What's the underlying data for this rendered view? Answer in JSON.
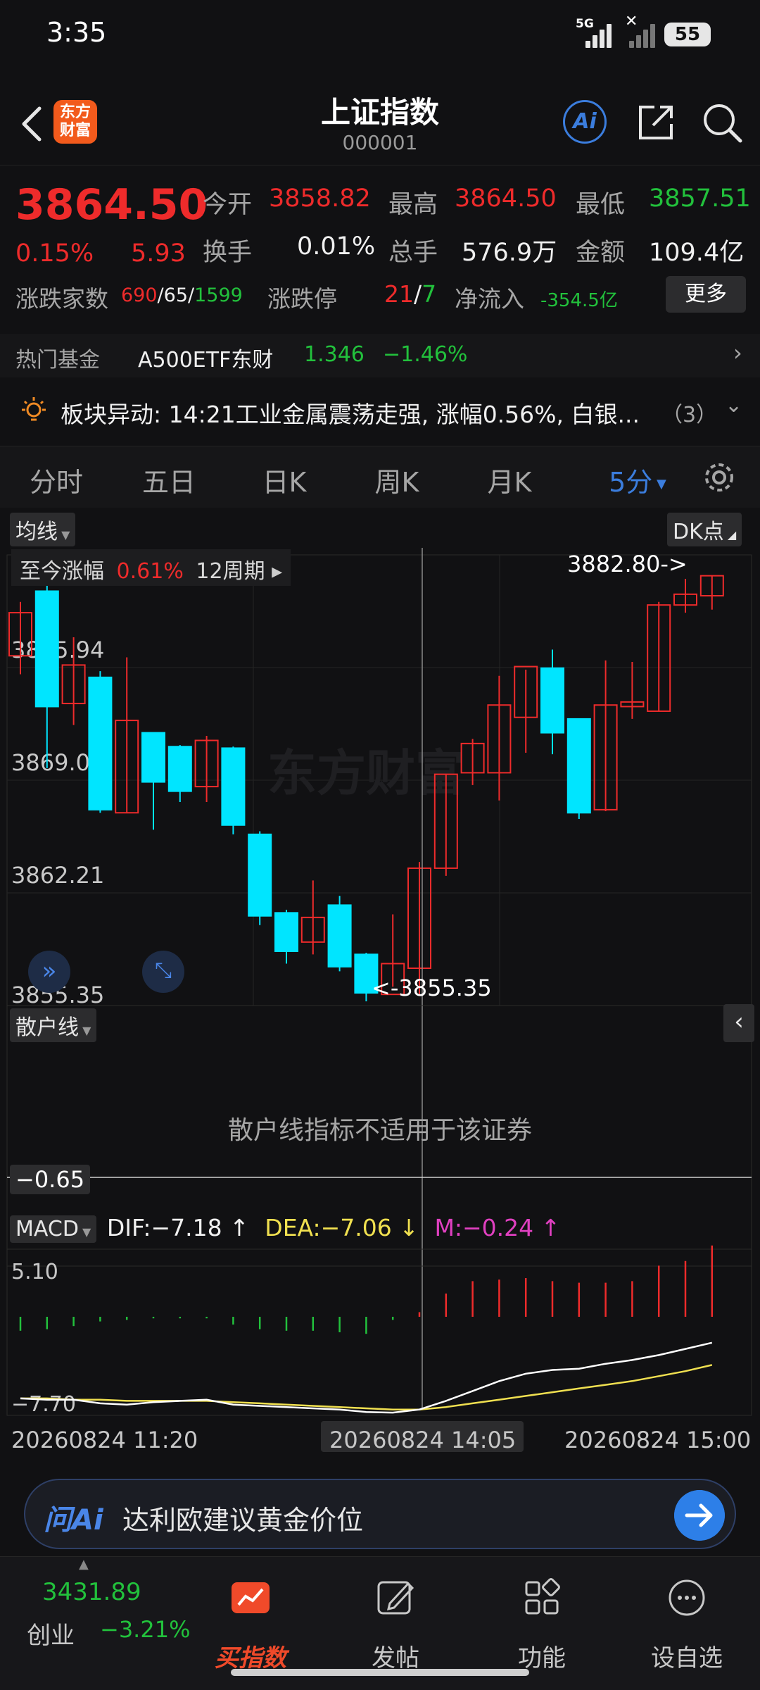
{
  "status_bar": {
    "time": "3:35",
    "network": "5G",
    "battery": "55"
  },
  "header": {
    "title": "上证指数",
    "code": "000001",
    "logo_text_1": "东方",
    "logo_text_2": "财富",
    "ai_label": "Ai"
  },
  "quote": {
    "price": "3864.50",
    "change_pct": "0.15%",
    "change_amt": "5.93",
    "open_label": "今开",
    "open": "3858.82",
    "high_label": "最高",
    "high": "3864.50",
    "low_label": "最低",
    "low": "3857.51",
    "turnover_label": "换手",
    "turnover": "0.01%",
    "volume_label": "总手",
    "volume": "576.9万",
    "amount_label": "金额",
    "amount": "109.4亿",
    "breadth_label": "涨跌家数",
    "breadth_up": "690",
    "breadth_flat": "/65/",
    "breadth_down": "1599",
    "limit_label": "涨跌停",
    "limit_up": "21",
    "limit_sep": "/",
    "limit_down": "7",
    "netflow_label": "净流入",
    "netflow": "-354.5亿",
    "more_label": "更多"
  },
  "hot_fund": {
    "label": "热门基金",
    "name": "A500ETF东财",
    "price": "1.346",
    "change": "−1.46%"
  },
  "news": {
    "text": "板块异动: 14:21工业金属震荡走强, 涨幅0.56%, 白银...",
    "count": "（3）"
  },
  "tabs": [
    {
      "label": "分时"
    },
    {
      "label": "五日"
    },
    {
      "label": "日K"
    },
    {
      "label": "周K"
    },
    {
      "label": "月K"
    },
    {
      "label": "5分"
    }
  ],
  "chart": {
    "ma_chip": "均线",
    "dk_chip": "DK点",
    "range_label": "至今涨幅",
    "range_pct": "0.61%",
    "range_period": "12周期",
    "max_annot": "3882.80->",
    "min_annot": "<-3855.35",
    "watermark": "东方财富",
    "price_ticks": [
      "3875.94",
      "3869.08",
      "3862.21",
      "3855.35"
    ],
    "retail_chip": "散户线",
    "retail_msg": "散户线指标不适用于该证券",
    "retail_value": "−0.65",
    "macd_chip": "MACD",
    "dif": "DIF:−7.18",
    "dea": "DEA:−7.06",
    "m": "M:−0.24",
    "macd_top": "5.10",
    "macd_bottom": "−7.70",
    "time_left": "20260824 11:20",
    "time_mid": "20260824 14:05",
    "time_right": "20260824 15:00"
  },
  "chart_data": {
    "type": "candlestick",
    "price_range": [
      3855.35,
      3882.8
    ],
    "candles": [
      {
        "o": 3877.8,
        "c": 3880.6,
        "h": 3881.3,
        "l": 3876.6,
        "dir": "up"
      },
      {
        "o": 3882.0,
        "c": 3874.5,
        "h": 3882.8,
        "l": 3870.5,
        "dir": "down"
      },
      {
        "o": 3874.7,
        "c": 3877.2,
        "h": 3879.0,
        "l": 3873.3,
        "dir": "up"
      },
      {
        "o": 3876.4,
        "c": 3867.8,
        "h": 3876.8,
        "l": 3867.6,
        "dir": "down"
      },
      {
        "o": 3867.6,
        "c": 3873.6,
        "h": 3877.7,
        "l": 3867.6,
        "dir": "up"
      },
      {
        "o": 3872.8,
        "c": 3869.6,
        "h": 3872.8,
        "l": 3866.5,
        "dir": "down"
      },
      {
        "o": 3869.0,
        "c": 3871.9,
        "h": 3872.0,
        "l": 3868.3,
        "dir": "down"
      },
      {
        "o": 3869.3,
        "c": 3872.3,
        "h": 3872.6,
        "l": 3868.3,
        "dir": "up"
      },
      {
        "o": 3871.8,
        "c": 3866.8,
        "h": 3871.9,
        "l": 3866.2,
        "dir": "down"
      },
      {
        "o": 3866.2,
        "c": 3860.9,
        "h": 3866.4,
        "l": 3860.3,
        "dir": "down"
      },
      {
        "o": 3861.1,
        "c": 3858.6,
        "h": 3861.3,
        "l": 3857.8,
        "dir": "down"
      },
      {
        "o": 3859.2,
        "c": 3860.8,
        "h": 3863.2,
        "l": 3858.4,
        "dir": "up"
      },
      {
        "o": 3861.6,
        "c": 3857.6,
        "h": 3862.2,
        "l": 3857.3,
        "dir": "down"
      },
      {
        "o": 3858.4,
        "c": 3855.9,
        "h": 3858.5,
        "l": 3855.35,
        "dir": "down"
      },
      {
        "o": 3855.8,
        "c": 3857.8,
        "h": 3861.0,
        "l": 3856.3,
        "dir": "up"
      },
      {
        "o": 3857.5,
        "c": 3864.0,
        "h": 3864.4,
        "l": 3855.8,
        "dir": "up"
      },
      {
        "o": 3864.0,
        "c": 3870.1,
        "h": 3870.1,
        "l": 3863.5,
        "dir": "up"
      },
      {
        "o": 3870.2,
        "c": 3872.1,
        "h": 3872.4,
        "l": 3869.4,
        "dir": "up"
      },
      {
        "o": 3870.2,
        "c": 3874.6,
        "h": 3876.5,
        "l": 3868.4,
        "dir": "up"
      },
      {
        "o": 3873.8,
        "c": 3877.1,
        "h": 3876.9,
        "l": 3871.5,
        "dir": "up"
      },
      {
        "o": 3877.0,
        "c": 3872.8,
        "h": 3878.2,
        "l": 3871.4,
        "dir": "down"
      },
      {
        "o": 3873.7,
        "c": 3867.6,
        "h": 3873.5,
        "l": 3867.2,
        "dir": "down"
      },
      {
        "o": 3867.8,
        "c": 3874.6,
        "h": 3877.5,
        "l": 3867.7,
        "dir": "up"
      },
      {
        "o": 3874.5,
        "c": 3874.8,
        "h": 3877.4,
        "l": 3873.7,
        "dir": "up"
      },
      {
        "o": 3874.2,
        "c": 3881.1,
        "h": 3881.3,
        "l": 3874.2,
        "dir": "up"
      },
      {
        "o": 3881.1,
        "c": 3881.8,
        "h": 3882.8,
        "l": 3880.6,
        "dir": "up"
      },
      {
        "o": 3881.7,
        "c": 3883.0,
        "h": 3883.0,
        "l": 3880.8,
        "dir": "up"
      }
    ],
    "macd_range": [
      -7.7,
      5.1
    ],
    "macd_hist": [
      -0.9,
      -0.8,
      -0.6,
      -0.3,
      -0.2,
      -0.1,
      -0.1,
      -0.1,
      -0.5,
      -0.8,
      -0.9,
      -0.9,
      -1.0,
      -1.1,
      -0.2,
      0.3,
      1.5,
      2.3,
      2.4,
      2.5,
      2.3,
      2.2,
      2.2,
      2.3,
      3.3,
      3.6,
      4.6
    ],
    "dif": [
      -6.5,
      -6.6,
      -6.6,
      -6.9,
      -7.0,
      -6.8,
      -6.7,
      -6.6,
      -7.0,
      -7.1,
      -7.2,
      -7.3,
      -7.4,
      -7.6,
      -7.65,
      -7.4,
      -6.7,
      -5.9,
      -5.1,
      -4.5,
      -4.2,
      -4.1,
      -3.7,
      -3.4,
      -3.0,
      -2.5,
      -2.0
    ],
    "dea": [
      -6.5,
      -6.5,
      -6.6,
      -6.6,
      -6.7,
      -6.7,
      -6.7,
      -6.7,
      -6.8,
      -6.9,
      -7.0,
      -7.1,
      -7.2,
      -7.3,
      -7.4,
      -7.4,
      -7.2,
      -6.9,
      -6.6,
      -6.3,
      -6.0,
      -5.7,
      -5.4,
      -5.1,
      -4.7,
      -4.3,
      -3.8
    ]
  },
  "ask_bar": {
    "brand": "问Ai",
    "prompt": "达利欧建议黄金价位"
  },
  "bottom_nav": {
    "index_price": "3431.89",
    "index_name": "创业",
    "index_change": "−3.21%",
    "items": [
      {
        "label": "买指数"
      },
      {
        "label": "发帖"
      },
      {
        "label": "功能"
      },
      {
        "label": "设自选"
      }
    ]
  },
  "colors": {
    "up": "#ee2b2b",
    "down": "#00e5ff",
    "accent": "#3b7ddd",
    "bg": "#111113"
  }
}
